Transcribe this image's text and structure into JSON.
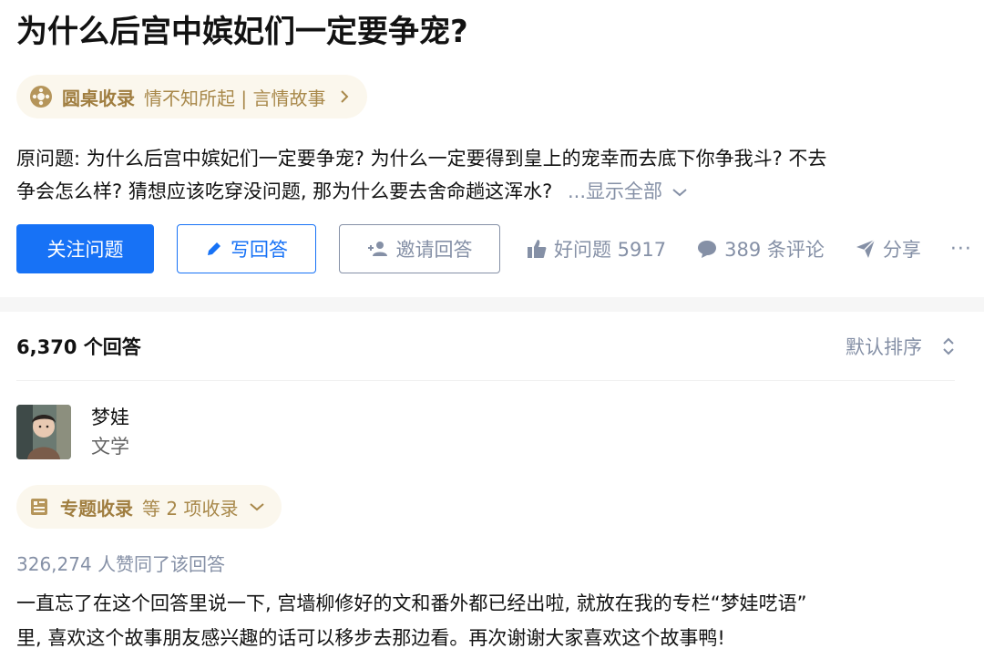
{
  "question": {
    "title": "为什么后宫中嫔妃们一定要争宠?",
    "roundtable": {
      "label": "圆桌收录",
      "topic": "情不知所起 | 言情故事"
    },
    "description_line1": "原问题: 为什么后宫中嫔妃们一定要争宠? 为什么一定要得到皇上的宠幸而去底下你争我斗? 不去",
    "description_line2": "争会怎么样? 猜想应该吃穿没问题, 那为什么要去舍命趟这浑水? ",
    "show_all": "...显示全部"
  },
  "actions": {
    "follow": "关注问题",
    "write": "写回答",
    "invite": "邀请回答",
    "good_question": "好问题 5917",
    "comments": "389 条评论",
    "share": "分享",
    "more": "···"
  },
  "answers": {
    "count": "6,370 个回答",
    "sort_label": "默认排序"
  },
  "answer": {
    "author_name": "梦娃",
    "author_bio": "文学",
    "collection_label": "专题收录",
    "collection_count": "等 2 项收录",
    "voters": "326,274 人赞同了该回答",
    "content_line1": "一直忘了在这个回答里说一下, 宫墙柳修好的文和番外都已经出啦, 就放在我的专栏“梦娃呓语”",
    "content_line2": "里, 喜欢这个故事朋友感兴趣的话可以移步去那边看。再次谢谢大家喜欢这个故事鸭!"
  },
  "colors": {
    "primary": "#1772f6",
    "muted": "#8590a6",
    "gold": "#a8884a",
    "gold_bg": "#fbf7ed"
  },
  "icons": [
    "roundtable-icon",
    "chevron-right-icon",
    "chevron-down-icon",
    "pencil-icon",
    "add-user-icon",
    "thumb-up-icon",
    "comment-icon",
    "share-icon",
    "sort-icon",
    "column-icon"
  ]
}
